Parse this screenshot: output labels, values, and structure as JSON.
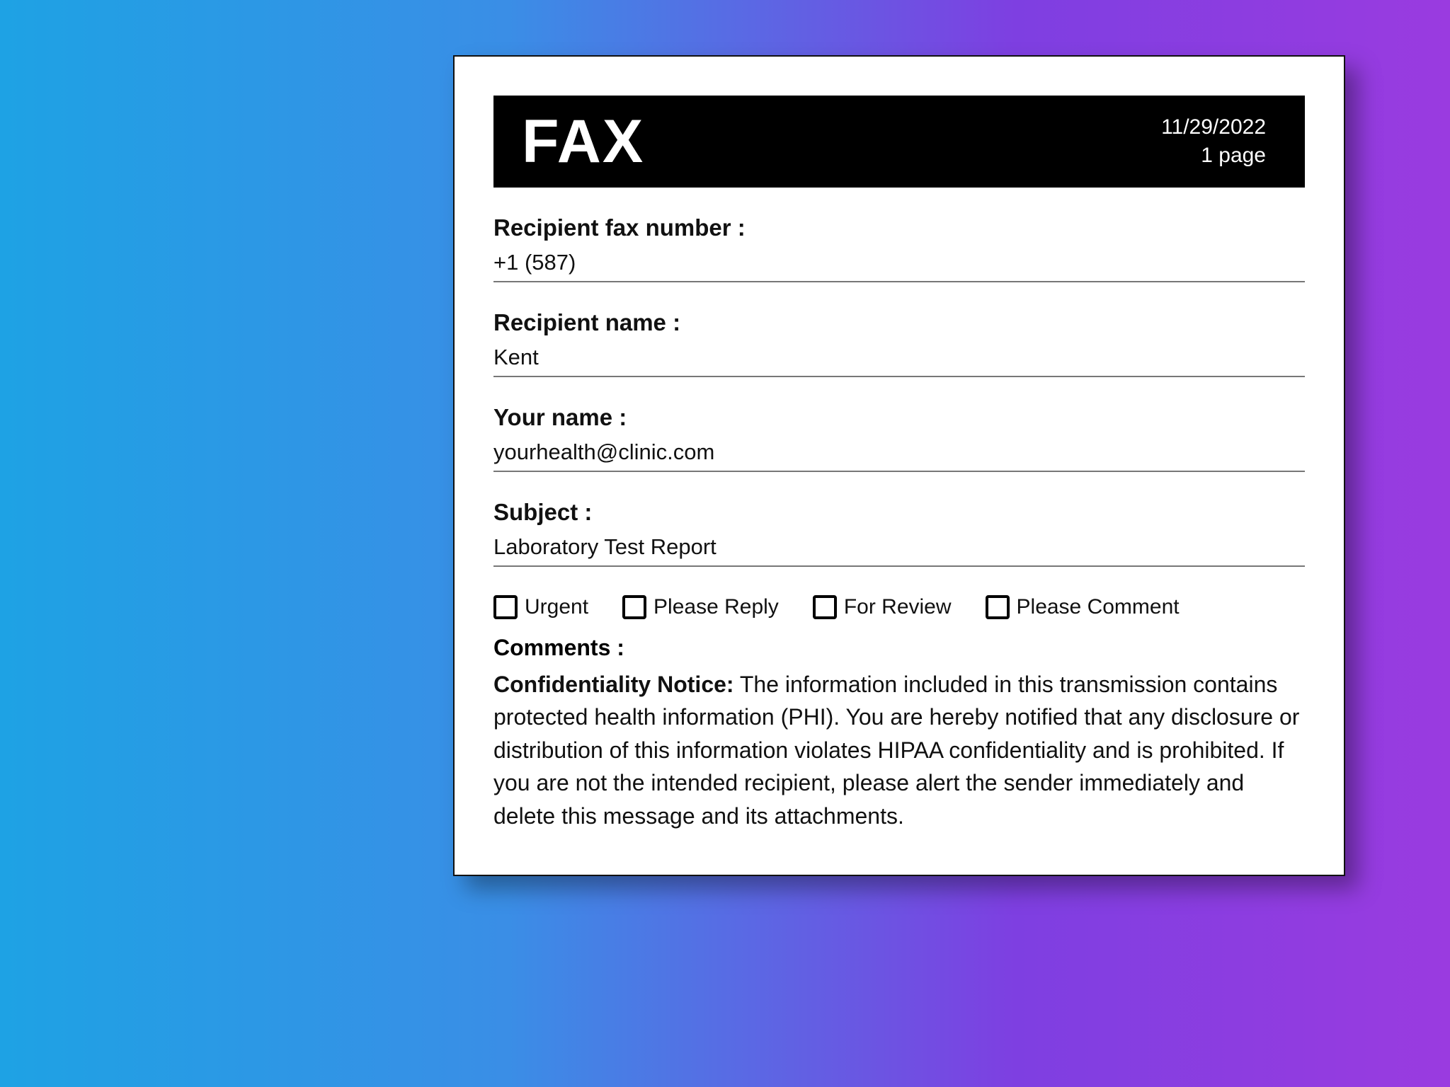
{
  "fax": {
    "title": "FAX",
    "date": "11/29/2022",
    "page_count_text": "1 page",
    "fields": {
      "recipient_fax_number": {
        "label": "Recipient fax number :",
        "value": "+1 (587)"
      },
      "recipient_name": {
        "label": "Recipient name :",
        "value": "Kent"
      },
      "your_name": {
        "label": "Your name :",
        "value": "yourhealth@clinic.com"
      },
      "subject": {
        "label": "Subject :",
        "value": "Laboratory Test Report"
      }
    },
    "checkboxes": [
      {
        "label": "Urgent",
        "checked": false
      },
      {
        "label": "Please Reply",
        "checked": false
      },
      {
        "label": "For Review",
        "checked": false
      },
      {
        "label": "Please Comment",
        "checked": false
      }
    ],
    "comments_label": "Comments :",
    "notice": {
      "heading": "Confidentiality Notice:",
      "body": " The information included in this transmission contains protected health information (PHI). You are hereby notified that any disclosure or distribution of this information violates HIPAA confidentiality and is prohibited. If you are not the intended recipient, please alert the sender immediately and delete this message and its attachments."
    }
  }
}
